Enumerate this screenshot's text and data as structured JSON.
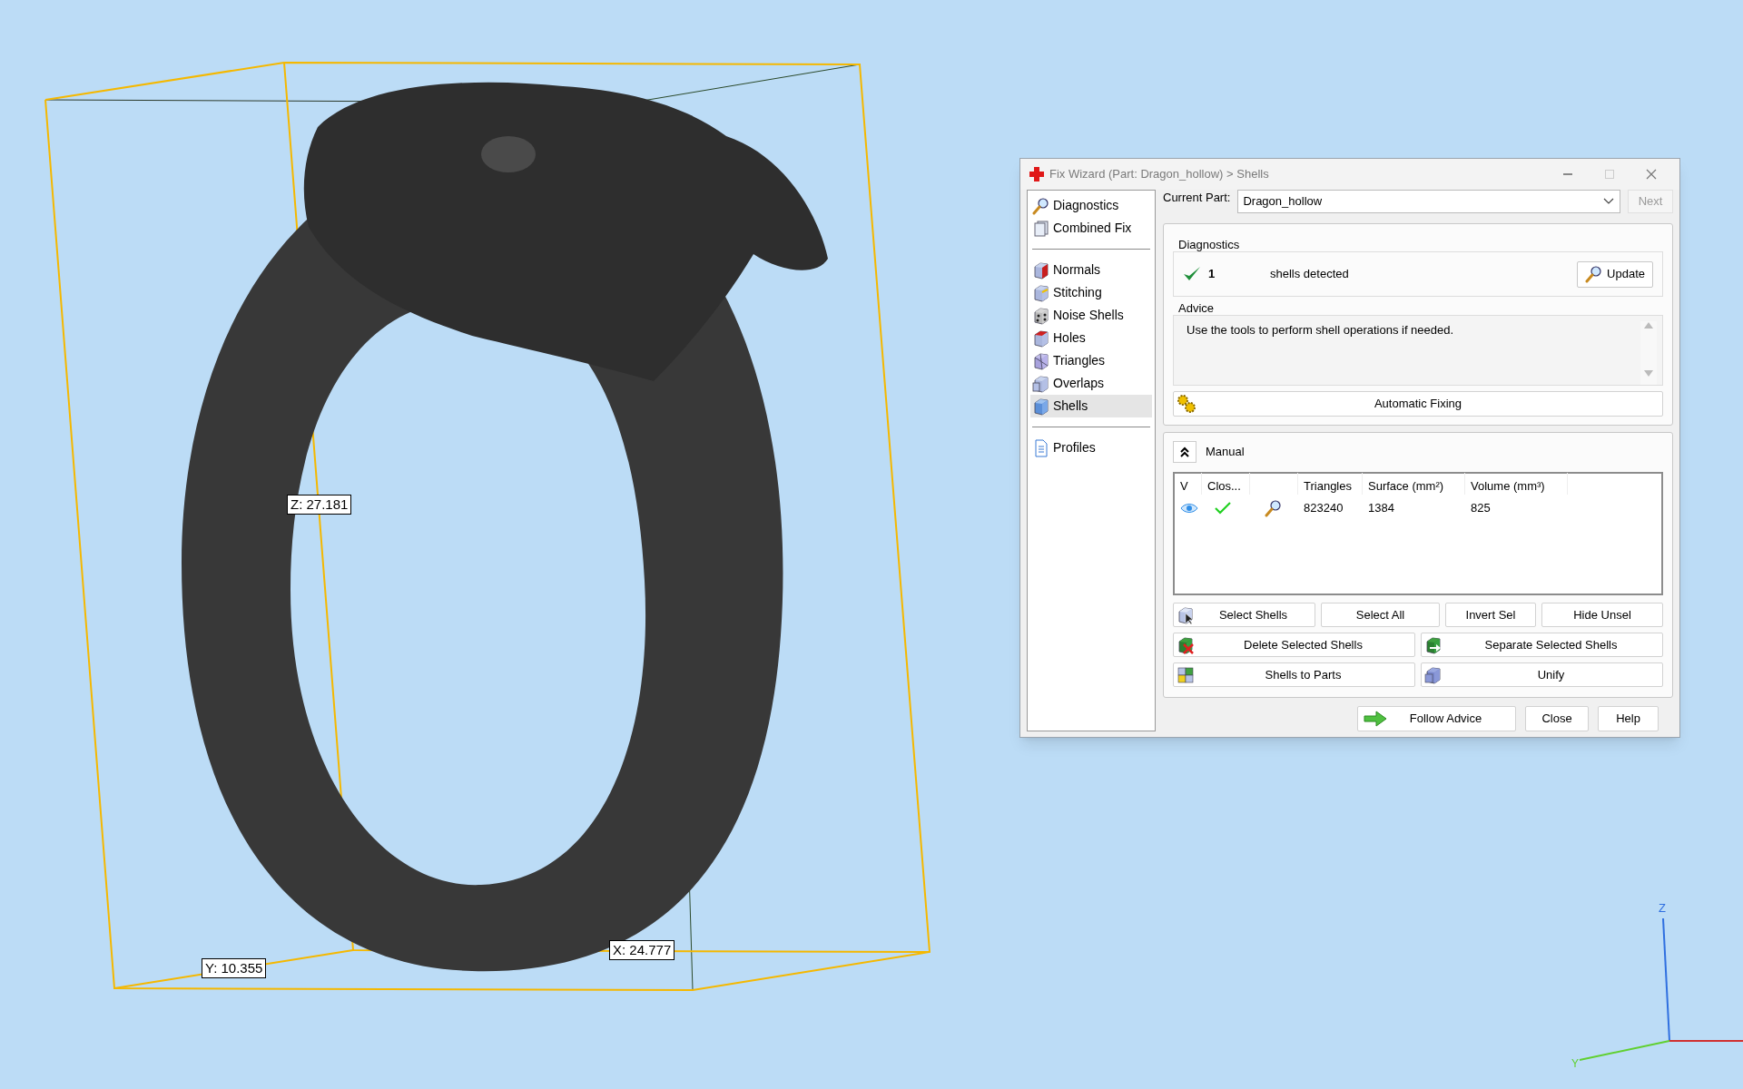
{
  "viewport": {
    "dimension_labels": [
      "Z: 27.181",
      "Y: 10.355",
      "X: 24.777"
    ],
    "axis_triad": {
      "z_label": "Z",
      "y_label": "Y"
    }
  },
  "dialog": {
    "title": "Fix Wizard (Part: Dragon_hollow) > Shells",
    "sidebar": [
      [
        {
          "label": "Diagnostics",
          "selected": false
        },
        {
          "label": "Combined Fix",
          "selected": false
        }
      ],
      [
        {
          "label": "Normals",
          "selected": false
        },
        {
          "label": "Stitching",
          "selected": false
        },
        {
          "label": "Noise Shells",
          "selected": false
        },
        {
          "label": "Holes",
          "selected": false
        },
        {
          "label": "Triangles",
          "selected": false
        },
        {
          "label": "Overlaps",
          "selected": false
        },
        {
          "label": "Shells",
          "selected": true
        }
      ],
      [
        {
          "label": "Profiles",
          "selected": false
        }
      ]
    ],
    "current_part": {
      "label": "Current Part:",
      "value": "Dragon_hollow"
    },
    "next_button": {
      "label": "Next",
      "disabled": true
    },
    "diagnostics": {
      "heading": "Diagnostics",
      "ok": true,
      "count": "1",
      "message": "shells detected",
      "update_button": "Update"
    },
    "advice": {
      "heading": "Advice",
      "text": "Use the tools to perform shell operations if needed."
    },
    "automatic_fixing_button": "Automatic Fixing",
    "manual": {
      "label": "Manual",
      "expanded": true,
      "columns": [
        "V",
        "Clos...",
        "Triangles",
        "Surface (mm²)",
        "Volume (mm³)"
      ],
      "rows": [
        {
          "visible": true,
          "closed": true,
          "triangles": "823240",
          "surface": "1384",
          "volume": "825"
        }
      ],
      "button_rows": [
        [
          "Select Shells",
          "Select All",
          "Invert Sel",
          "Hide Unsel"
        ],
        [
          "Delete Selected Shells",
          "Separate Selected Shells"
        ],
        [
          "Shells to Parts",
          "Unify"
        ]
      ]
    },
    "footer_buttons": [
      "Follow Advice",
      "Close",
      "Help"
    ]
  }
}
